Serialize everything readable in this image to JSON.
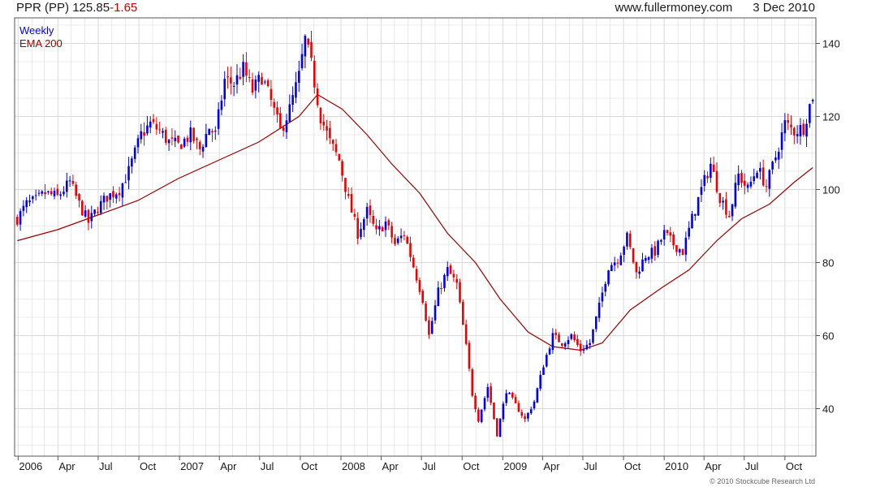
{
  "header": {
    "symbol": "PPR (PP)",
    "last": "125.85",
    "change": "-1.65",
    "site": "www.fullermoney.com",
    "date": "3 Dec 2010"
  },
  "legend": {
    "interval": "Weekly",
    "indicator": "EMA 200"
  },
  "credit": "© 2010 Stockcube Research Ltd",
  "colors": {
    "up": "#0000ee",
    "down": "#ee0000",
    "ema": "#990000",
    "grid": "#d9d9d9",
    "frame": "#555555"
  },
  "chart_data": {
    "type": "candlestick",
    "interval": "weekly",
    "ylim": [
      27,
      147
    ],
    "y_ticks": [
      40,
      60,
      80,
      100,
      120,
      140
    ],
    "x_ticks": [
      "2006",
      "Apr",
      "Jul",
      "Oct",
      "2007",
      "Apr",
      "Jul",
      "Oct",
      "2008",
      "Apr",
      "Jul",
      "Oct",
      "2009",
      "Apr",
      "Jul",
      "Oct",
      "2010",
      "Apr",
      "Jul",
      "Oct"
    ],
    "close_path": [
      [
        "2005-12-30",
        92
      ],
      [
        "2006-01-20",
        96
      ],
      [
        "2006-02-10",
        97
      ],
      [
        "2006-03-03",
        99
      ],
      [
        "2006-03-31",
        98
      ],
      [
        "2006-04-28",
        102
      ],
      [
        "2006-05-19",
        96
      ],
      [
        "2006-06-09",
        91
      ],
      [
        "2006-06-30",
        95
      ],
      [
        "2006-07-21",
        98
      ],
      [
        "2006-08-18",
        100
      ],
      [
        "2006-09-08",
        105
      ],
      [
        "2006-10-06",
        115
      ],
      [
        "2006-10-27",
        118
      ],
      [
        "2006-11-17",
        116
      ],
      [
        "2006-12-08",
        113
      ],
      [
        "2006-12-29",
        112
      ],
      [
        "2007-01-26",
        115
      ],
      [
        "2007-02-16",
        111
      ],
      [
        "2007-03-09",
        117
      ],
      [
        "2007-03-23",
        115
      ],
      [
        "2007-04-13",
        130
      ],
      [
        "2007-05-04",
        129
      ],
      [
        "2007-05-25",
        133
      ],
      [
        "2007-06-15",
        127
      ],
      [
        "2007-07-06",
        131
      ],
      [
        "2007-07-27",
        124
      ],
      [
        "2007-08-17",
        116
      ],
      [
        "2007-09-07",
        122
      ],
      [
        "2007-09-28",
        131
      ],
      [
        "2007-10-12",
        141
      ],
      [
        "2007-10-26",
        134
      ],
      [
        "2007-11-16",
        120
      ],
      [
        "2007-12-07",
        113
      ],
      [
        "2007-12-28",
        108
      ],
      [
        "2008-01-18",
        97
      ],
      [
        "2008-02-08",
        88
      ],
      [
        "2008-02-29",
        94
      ],
      [
        "2008-03-21",
        88
      ],
      [
        "2008-04-11",
        91
      ],
      [
        "2008-05-02",
        85
      ],
      [
        "2008-05-23",
        88
      ],
      [
        "2008-06-13",
        79
      ],
      [
        "2008-07-04",
        70
      ],
      [
        "2008-07-18",
        60
      ],
      [
        "2008-08-08",
        72
      ],
      [
        "2008-08-29",
        78
      ],
      [
        "2008-09-19",
        74
      ],
      [
        "2008-10-10",
        57
      ],
      [
        "2008-10-24",
        44
      ],
      [
        "2008-11-07",
        37
      ],
      [
        "2008-11-28",
        46
      ],
      [
        "2008-12-19",
        33
      ],
      [
        "2009-01-09",
        45
      ],
      [
        "2009-01-30",
        41
      ],
      [
        "2009-02-20",
        37
      ],
      [
        "2009-03-13",
        42
      ],
      [
        "2009-04-03",
        52
      ],
      [
        "2009-04-24",
        60
      ],
      [
        "2009-05-15",
        58
      ],
      [
        "2009-06-05",
        60
      ],
      [
        "2009-06-26",
        56
      ],
      [
        "2009-07-17",
        58
      ],
      [
        "2009-08-07",
        68
      ],
      [
        "2009-08-28",
        79
      ],
      [
        "2009-09-18",
        81
      ],
      [
        "2009-10-09",
        87
      ],
      [
        "2009-10-30",
        77
      ],
      [
        "2009-11-20",
        82
      ],
      [
        "2009-12-11",
        83
      ],
      [
        "2010-01-01",
        88
      ],
      [
        "2010-01-22",
        85
      ],
      [
        "2010-02-12",
        83
      ],
      [
        "2010-03-05",
        92
      ],
      [
        "2010-03-26",
        100
      ],
      [
        "2010-04-16",
        107
      ],
      [
        "2010-05-07",
        98
      ],
      [
        "2010-05-28",
        93
      ],
      [
        "2010-06-18",
        104
      ],
      [
        "2010-07-09",
        100
      ],
      [
        "2010-07-30",
        106
      ],
      [
        "2010-08-20",
        101
      ],
      [
        "2010-09-10",
        109
      ],
      [
        "2010-10-01",
        118
      ],
      [
        "2010-10-22",
        116
      ],
      [
        "2010-11-12",
        117
      ],
      [
        "2010-11-26",
        123
      ],
      [
        "2010-12-03",
        125.85
      ]
    ],
    "ema": {
      "name": "EMA 200",
      "points": [
        [
          "2005-12-30",
          86
        ],
        [
          "2006-03-31",
          89
        ],
        [
          "2006-06-30",
          93
        ],
        [
          "2006-09-29",
          97
        ],
        [
          "2006-12-29",
          103
        ],
        [
          "2007-03-30",
          108
        ],
        [
          "2007-06-29",
          113
        ],
        [
          "2007-09-28",
          120
        ],
        [
          "2007-11-09",
          126
        ],
        [
          "2008-01-04",
          122
        ],
        [
          "2008-02-29",
          115
        ],
        [
          "2008-04-25",
          107
        ],
        [
          "2008-06-27",
          99
        ],
        [
          "2008-08-29",
          88
        ],
        [
          "2008-10-31",
          80
        ],
        [
          "2008-12-26",
          70
        ],
        [
          "2009-02-27",
          61
        ],
        [
          "2009-04-24",
          57
        ],
        [
          "2009-06-26",
          56
        ],
        [
          "2009-08-14",
          58
        ],
        [
          "2009-10-16",
          67
        ],
        [
          "2009-12-25",
          73
        ],
        [
          "2010-02-26",
          78
        ],
        [
          "2010-04-30",
          86
        ],
        [
          "2010-06-25",
          92
        ],
        [
          "2010-08-27",
          96
        ],
        [
          "2010-10-22",
          102
        ],
        [
          "2010-12-03",
          106
        ]
      ]
    }
  }
}
